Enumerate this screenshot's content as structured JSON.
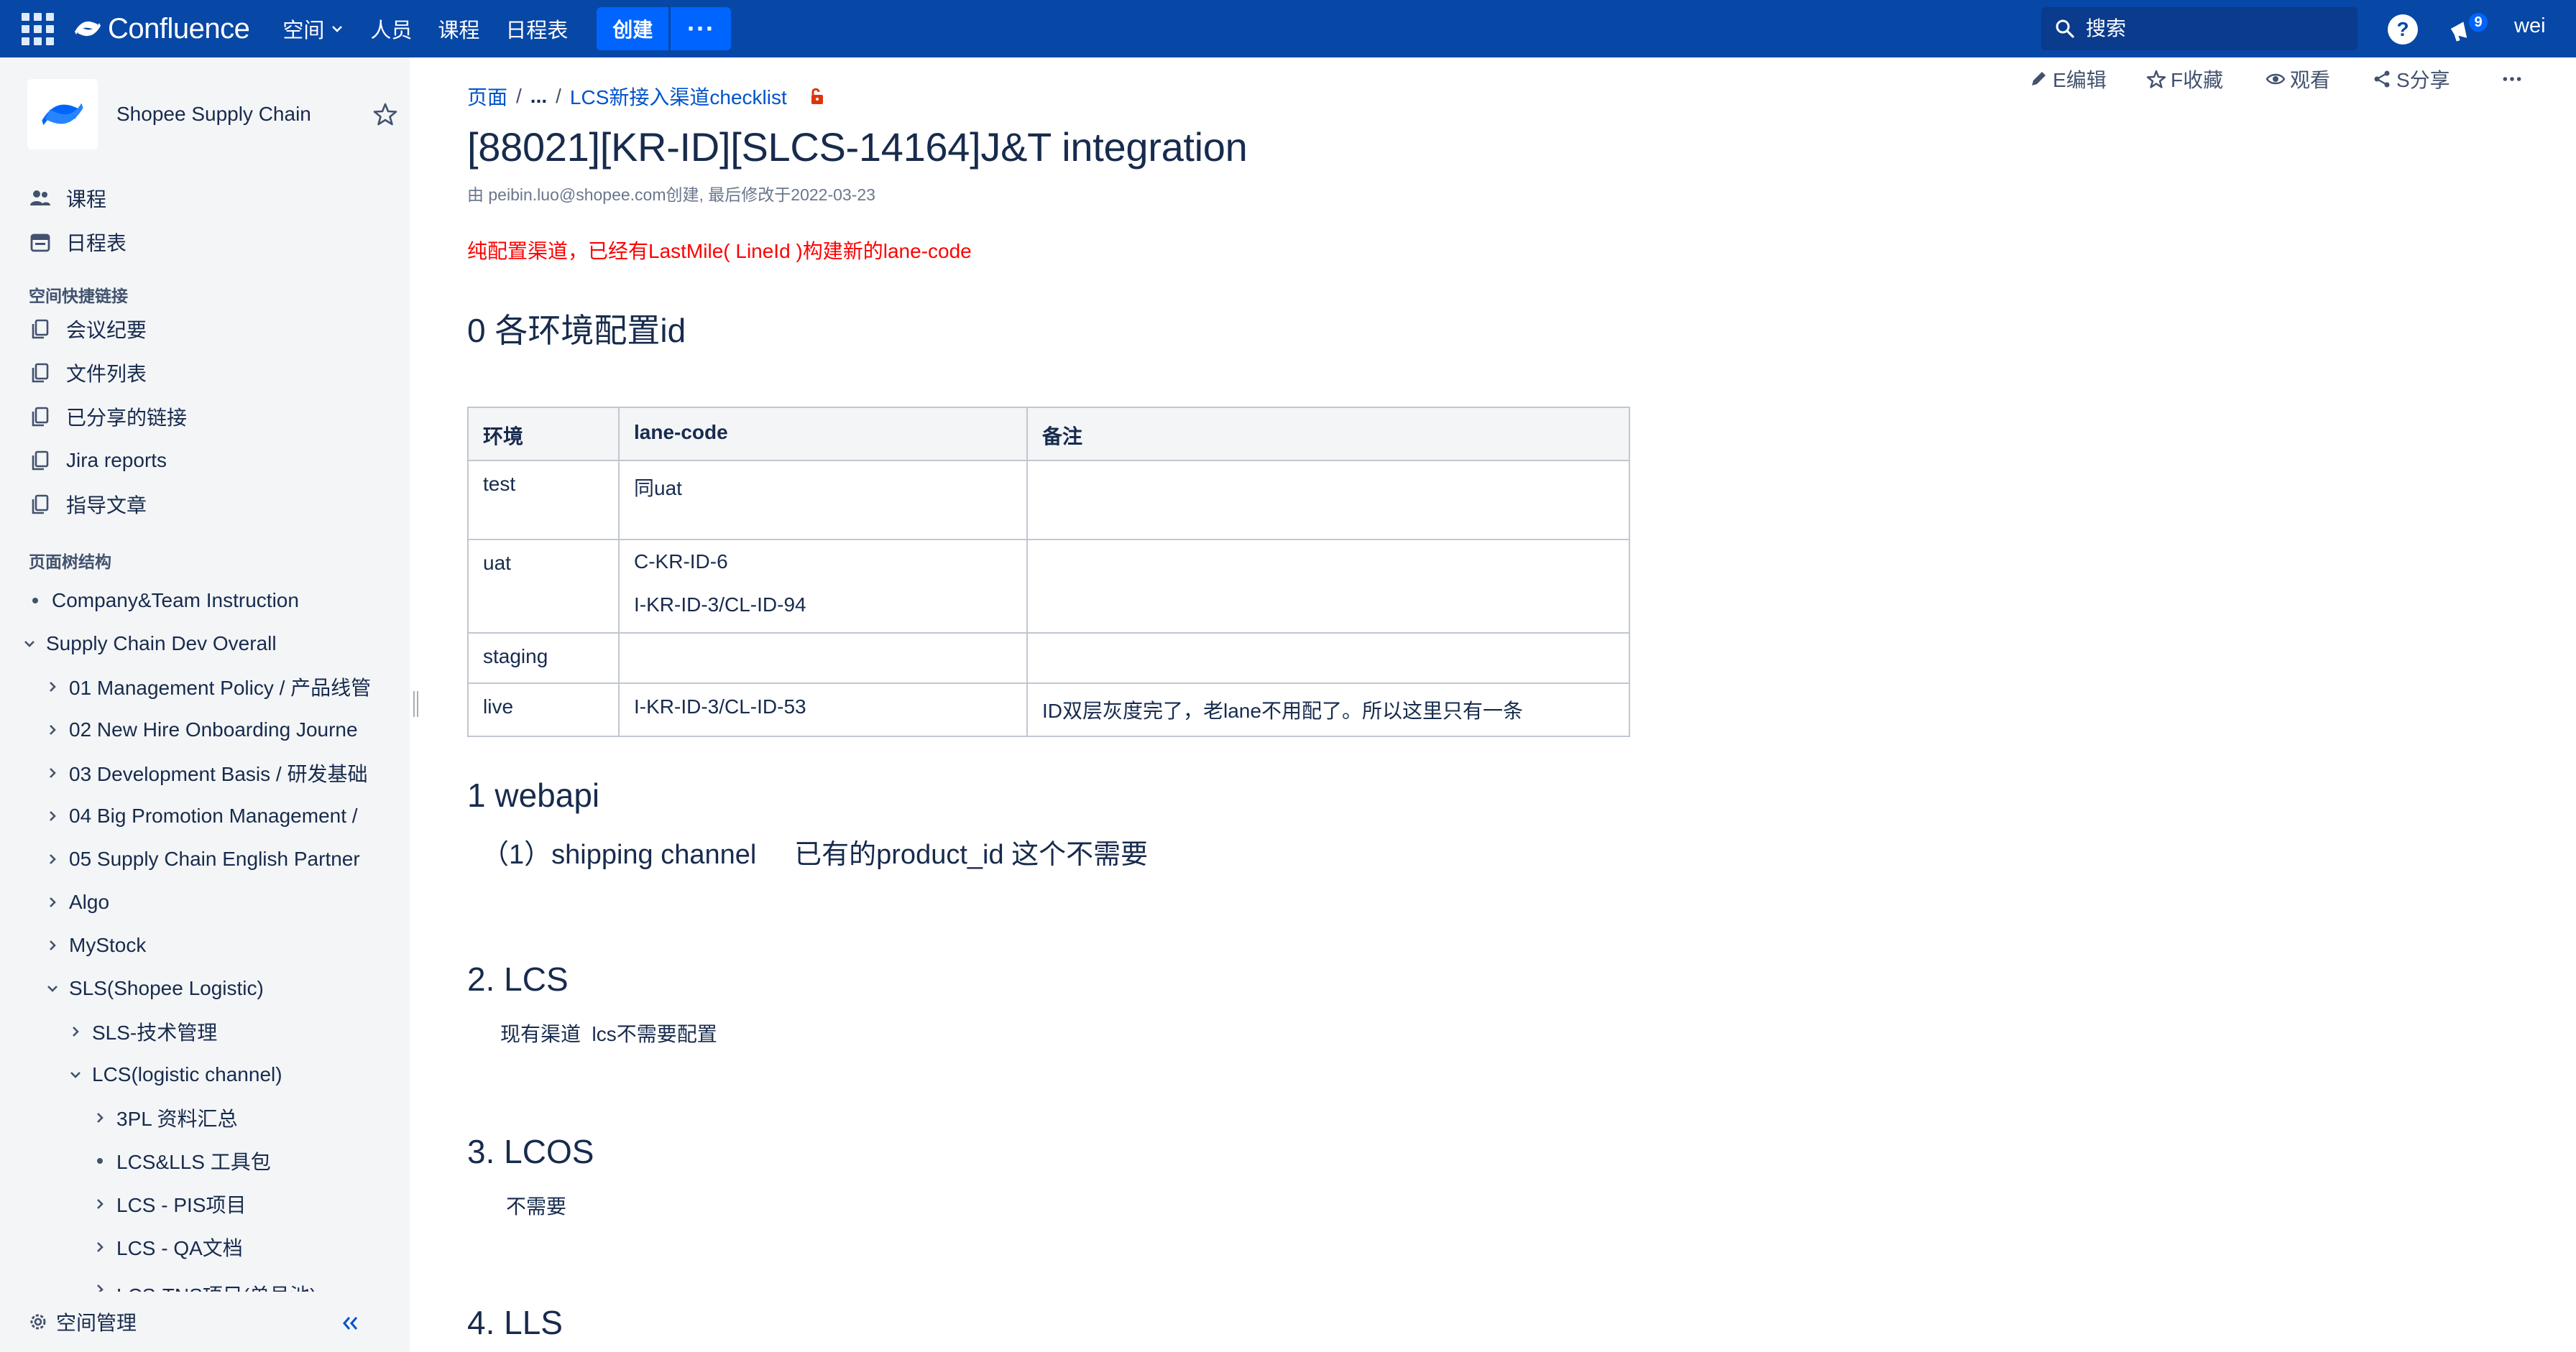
{
  "topnav": {
    "brand": "Confluence",
    "items": [
      "空间",
      "人员",
      "课程",
      "日程表"
    ],
    "create_label": "创建",
    "more_label": "···",
    "search_placeholder": "搜索",
    "notification_count": "9",
    "user": "wei"
  },
  "sidebar": {
    "space_name": "Shopee Supply Chain",
    "main_links": [
      "课程",
      "日程表"
    ],
    "shortcuts_heading": "空间快捷链接",
    "shortcuts": [
      "会议纪要",
      "文件列表",
      "已分享的链接",
      "Jira reports",
      "指导文章"
    ],
    "tree_heading": "页面树结构",
    "tree": [
      "Company&Team Instruction",
      "Supply Chain Dev Overall",
      "01 Management Policy / 产品线管",
      "02 New Hire Onboarding Journe",
      "03 Development Basis / 研发基础",
      "04 Big Promotion Management /",
      "05 Supply Chain English Partner",
      "Algo",
      "MyStock",
      "SLS(Shopee Logistic)",
      "SLS-技术管理",
      "LCS(logistic channel)",
      "3PL 资料汇总",
      "LCS&LLS 工具包",
      "LCS - PIS项目",
      "LCS - QA文档",
      "LCS-TNS项目(单号池)"
    ],
    "settings_label": "空间管理"
  },
  "page": {
    "breadcrumb": [
      "页面",
      "...",
      "LCS新接入渠道checklist"
    ],
    "actions": {
      "edit": "E编辑",
      "favorite": "F收藏",
      "watch": "观看",
      "share": "S分享"
    },
    "title": "[88021][KR-ID][SLCS-14164]J&T integration",
    "byline": "由 peibin.luo@shopee.com创建, 最后修改于2022-03-23",
    "note": "纯配置渠道，已经有LastMile( LineId )构建新的lane-code",
    "sections": {
      "s0": "0 各环境配置id",
      "s1": "1 webapi",
      "s1_text": "（1）shipping channel     已有的product_id 这个不需要",
      "s2": "2. LCS",
      "s2_text": "现有渠道  lcs不需要配置",
      "s3": "3. LCOS",
      "s3_text": "不需要",
      "s4": "4. LLS"
    },
    "table": {
      "headers": [
        "环境",
        "lane-code",
        "备注"
      ],
      "rows": [
        {
          "env": "test",
          "lane": [
            "同uat"
          ],
          "note": ""
        },
        {
          "env": "uat",
          "lane": [
            "C-KR-ID-6",
            "I-KR-ID-3/CL-ID-94"
          ],
          "note": ""
        },
        {
          "env": "staging",
          "lane": [
            ""
          ],
          "note": ""
        },
        {
          "env": "live",
          "lane": [
            "I-KR-ID-3/CL-ID-53"
          ],
          "note": "ID双层灰度完了，老lane不用配了。所以这里只有一条"
        }
      ]
    }
  },
  "colors": {
    "topbar": "#0747a6",
    "create_button": "#0065ff",
    "link": "#0052cc",
    "sidebar_bg": "#f4f5f7",
    "red_note": "#ff0000"
  }
}
